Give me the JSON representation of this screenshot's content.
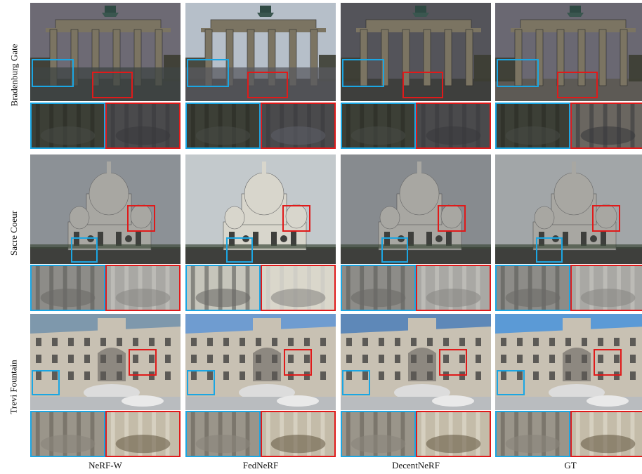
{
  "rows": [
    {
      "label": "Bradenburg Gate"
    },
    {
      "label": "Sacre Coeur"
    },
    {
      "label": "Trevi Fountain"
    }
  ],
  "columns": [
    {
      "label": "NeRF-W"
    },
    {
      "label": "FedNeRF"
    },
    {
      "label": "DecentNeRF"
    },
    {
      "label": "GT"
    }
  ],
  "colors": {
    "highlight_blue": "#1ba6e3",
    "highlight_red": "#e01a1a"
  }
}
